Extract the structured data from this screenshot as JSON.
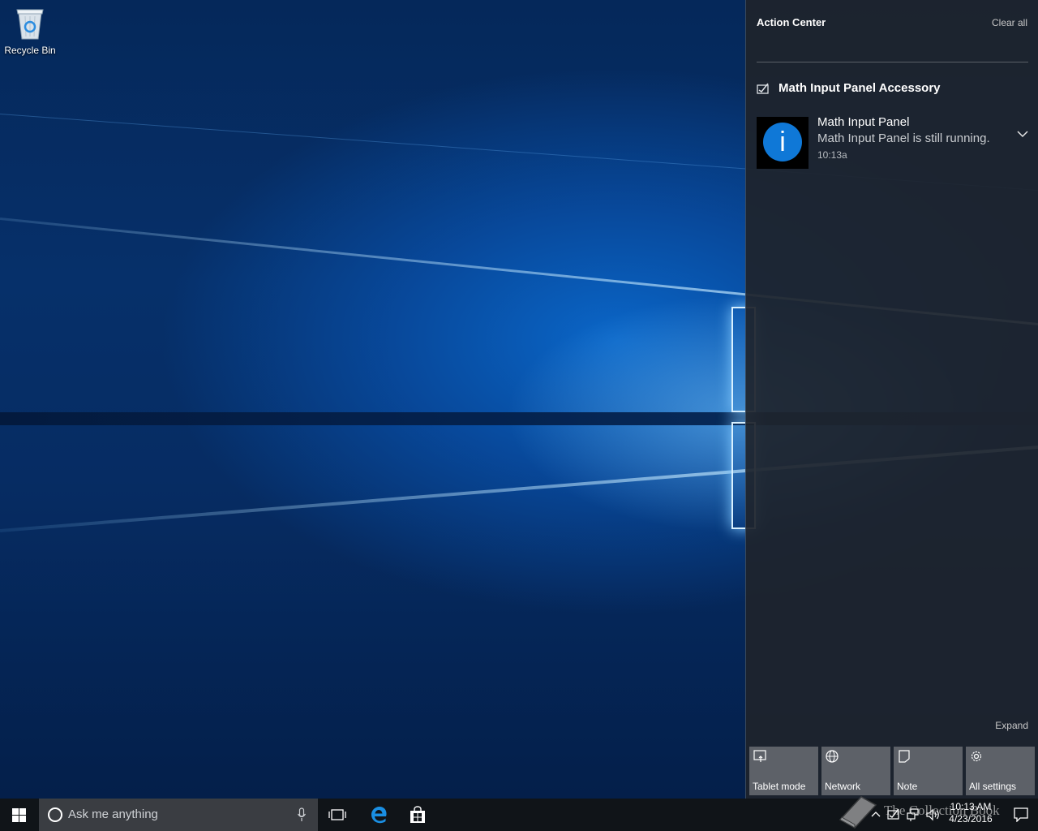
{
  "desktop": {
    "icons": [
      {
        "label": "Recycle Bin",
        "icon": "recycle-bin-icon"
      }
    ]
  },
  "action_center": {
    "title": "Action Center",
    "clear_all": "Clear all",
    "group": {
      "icon": "math-input-panel-icon",
      "name": "Math Input Panel Accessory"
    },
    "notification": {
      "icon": "info-icon",
      "icon_glyph": "i",
      "title": "Math Input Panel",
      "body": "Math Input Panel is still running.",
      "time": "10:13a",
      "expand_icon": "chevron-down-icon"
    },
    "expand_label": "Expand",
    "quick_actions": [
      {
        "label": "Tablet mode",
        "icon": "tablet-mode-icon"
      },
      {
        "label": "Network",
        "icon": "globe-icon"
      },
      {
        "label": "Note",
        "icon": "note-icon"
      },
      {
        "label": "All settings",
        "icon": "gear-icon"
      }
    ],
    "accent_color": "#0f78d7"
  },
  "taskbar": {
    "search_placeholder": "Ask me anything",
    "apps": [
      {
        "name": "Task View",
        "icon": "task-view-icon"
      },
      {
        "name": "Microsoft Edge",
        "icon": "edge-icon"
      },
      {
        "name": "Store",
        "icon": "store-icon"
      }
    ],
    "tray_icons": [
      "chevron-up-icon",
      "math-input-panel-icon",
      "network-icon",
      "volume-icon"
    ],
    "clock_time": "10:13 AM",
    "clock_date": "4/23/2016"
  },
  "watermark": {
    "text": "The Collection Book",
    "icon": "book-icon"
  }
}
